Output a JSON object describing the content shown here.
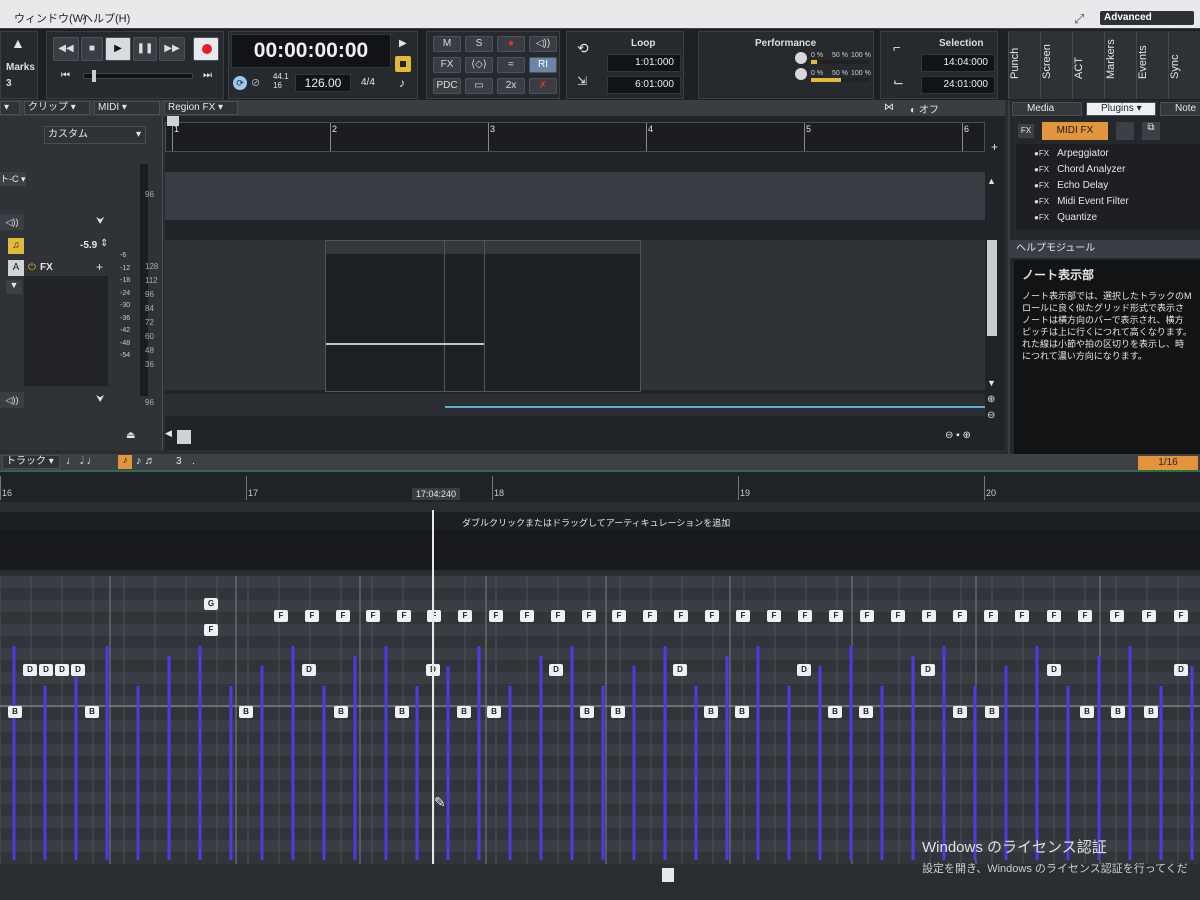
{
  "menu": {
    "window": "ウィンドウ(W)",
    "help": "ヘルプ(H)",
    "workspace": "Advanced"
  },
  "transport": {
    "marks": "Marks",
    "marks_count": "3",
    "time": "00:00:00:00",
    "sample_rate": "44.1",
    "bit_depth": "16",
    "tempo": "126.00",
    "meter": "4/4"
  },
  "modules": {
    "m": "M",
    "s": "S",
    "fx": "FX",
    "ri": "RI",
    "pdc": "PDC",
    "x2": "2x",
    "loop_title": "Loop",
    "loop_start": "1:01:000",
    "loop_end": "6:01:000",
    "perf_title": "Performance",
    "perf_meter_labels": [
      "0 %",
      "50 %",
      "100 %"
    ],
    "sel_title": "Selection",
    "sel_start": "14:04:000",
    "sel_end": "24:01:000"
  },
  "vtabs": [
    "Punch",
    "Screen",
    "ACT",
    "Markers",
    "Events",
    "Sync"
  ],
  "clip_toolbar": {
    "clip": "クリップ",
    "midi": "MIDI",
    "region_fx": "Region FX",
    "off": "オフ"
  },
  "inspector": {
    "preset": "カスタム",
    "volume": "-5.9",
    "fx": "FX",
    "meter_scale": [
      "-6",
      "-12",
      "-18",
      "-24",
      "-30",
      "-36",
      "-42",
      "-48",
      "-54"
    ],
    "lane_labels": [
      "96",
      "128",
      "112",
      "96",
      "84",
      "72",
      "60",
      "48",
      "36",
      "96"
    ]
  },
  "ruler": {
    "bars": [
      "1",
      "2",
      "3",
      "4",
      "5",
      "6"
    ]
  },
  "browser": {
    "tabs": [
      "Media",
      "Plugins",
      "Note"
    ],
    "category": "MIDI FX",
    "plugins": [
      "Arpeggiator",
      "Chord Analyzer",
      "Echo Delay",
      "Midi Event Filter",
      "Quantize"
    ],
    "help_header": "ヘルプモジュール",
    "help_title": "ノート表示部",
    "help_lines": [
      "ノート表示部では、選択したトラックのM",
      "ロールに良く似たグリッド形式で表示さ",
      "ノートは横方向のバーで表示され、横方",
      "ピッチは上に行くにつれて高くなります。",
      "れた線は小節や拍の区切りを表示し、時",
      "につれて濃い方向になります。"
    ]
  },
  "prv": {
    "track": "トラック",
    "triplet": "3",
    "zoom_fraction": "1/16"
  },
  "timeline": {
    "labels": [
      "16",
      "17",
      "18",
      "19",
      "20"
    ],
    "now": "17:04:240"
  },
  "articulation": {
    "hint": "ダブルクリックまたはドラッグしてアーティキュレーションを追加"
  },
  "watermark": {
    "title": "Windows のライセンス認証",
    "sub": "設定を開き、Windows のライセンス認証を行ってくだ"
  },
  "notes": {
    "pitch_g": "G",
    "pitch_f": "F",
    "pitch_d": "D",
    "pitch_b": "B",
    "f_positions": [
      211,
      274,
      305,
      336,
      366,
      397,
      427,
      458,
      489,
      520,
      551,
      582,
      612,
      643,
      674,
      705,
      736,
      767,
      798,
      829,
      860,
      891,
      922,
      953,
      984,
      1015,
      1047,
      1078,
      1110,
      1142,
      1174
    ],
    "d_positions": [
      23,
      39,
      55,
      71,
      302,
      426,
      549,
      673,
      797,
      921,
      1047,
      1174
    ],
    "b_positions": [
      8,
      85,
      239,
      334,
      395,
      457,
      487,
      580,
      611,
      704,
      735,
      828,
      859,
      953,
      985,
      1080,
      1111,
      1144
    ]
  }
}
